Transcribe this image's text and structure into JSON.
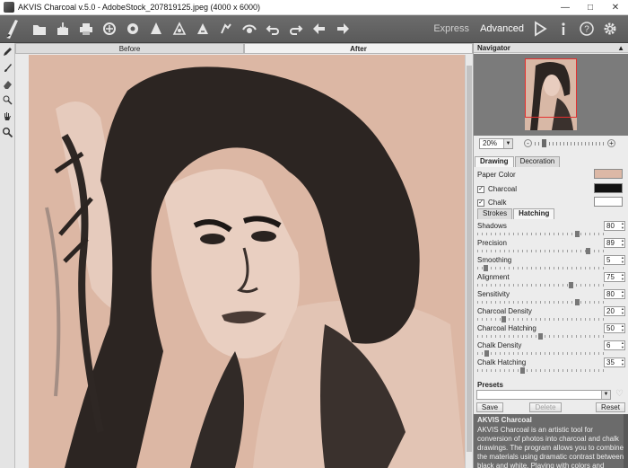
{
  "window": {
    "title": "AKVIS Charcoal v.5.0 - AdobeStock_207819125.jpeg (4000 x 6000)",
    "controls": [
      "minimize",
      "maximize",
      "close"
    ]
  },
  "toolbar": {
    "left_buttons": [
      "open-icon",
      "save-icon",
      "print-icon",
      "share-icon",
      "batch-icon",
      "preferences-icon",
      "plugin-icon",
      "run-icon",
      "settings-icon",
      "share2-icon",
      "undo-icon",
      "redo-icon"
    ],
    "nav_buttons": [
      "back-icon",
      "forward-icon"
    ],
    "mode_express": "Express",
    "mode_advanced": "Advanced",
    "right_buttons": [
      "run-icon",
      "info-icon",
      "help-icon",
      "gear-icon"
    ]
  },
  "tools": [
    "pencil-icon",
    "brush-icon",
    "eraser-icon",
    "mixer-icon",
    "hand-icon",
    "zoom-icon"
  ],
  "canvas": {
    "tab_before": "Before",
    "tab_after": "After"
  },
  "navigator": {
    "title": "Navigator",
    "zoom_value": "20%",
    "zoom_level": 0.12
  },
  "sections": {
    "drawing_tab": "Drawing",
    "decoration_tab": "Decoration",
    "paper_color_label": "Paper Color",
    "paper_color": "#dcb8a6",
    "charcoal_label": "Charcoal",
    "charcoal_color": "#111111",
    "chalk_label": "Chalk",
    "chalk_color": "#ffffff",
    "strokes_tab": "Strokes",
    "hatching_tab": "Hatching"
  },
  "params": [
    {
      "label": "Shadows",
      "value": "80",
      "level": 0.8
    },
    {
      "label": "Precision",
      "value": "89",
      "level": 0.89
    },
    {
      "label": "Smoothing",
      "value": "5",
      "level": 0.05
    },
    {
      "label": "Alignment",
      "value": "75",
      "level": 0.75
    },
    {
      "label": "Sensitivity",
      "value": "80",
      "level": 0.8
    },
    {
      "label": "Charcoal Density",
      "value": "20",
      "level": 0.2
    },
    {
      "label": "Charcoal Hatching",
      "value": "50",
      "level": 0.5
    },
    {
      "label": "Chalk Density",
      "value": "6",
      "level": 0.06
    },
    {
      "label": "Chalk Hatching",
      "value": "35",
      "level": 0.35
    }
  ],
  "presets": {
    "title": "Presets",
    "selected": "",
    "save_label": "Save",
    "delete_label": "Delete",
    "reset_label": "Reset"
  },
  "help": {
    "title": "AKVIS Charcoal",
    "text": "AKVIS Charcoal is an artistic tool for conversion of photos into charcoal and chalk drawings. The program allows you to combine the materials using dramatic contrast between black and white. Playing with colors and options you can achieve"
  }
}
